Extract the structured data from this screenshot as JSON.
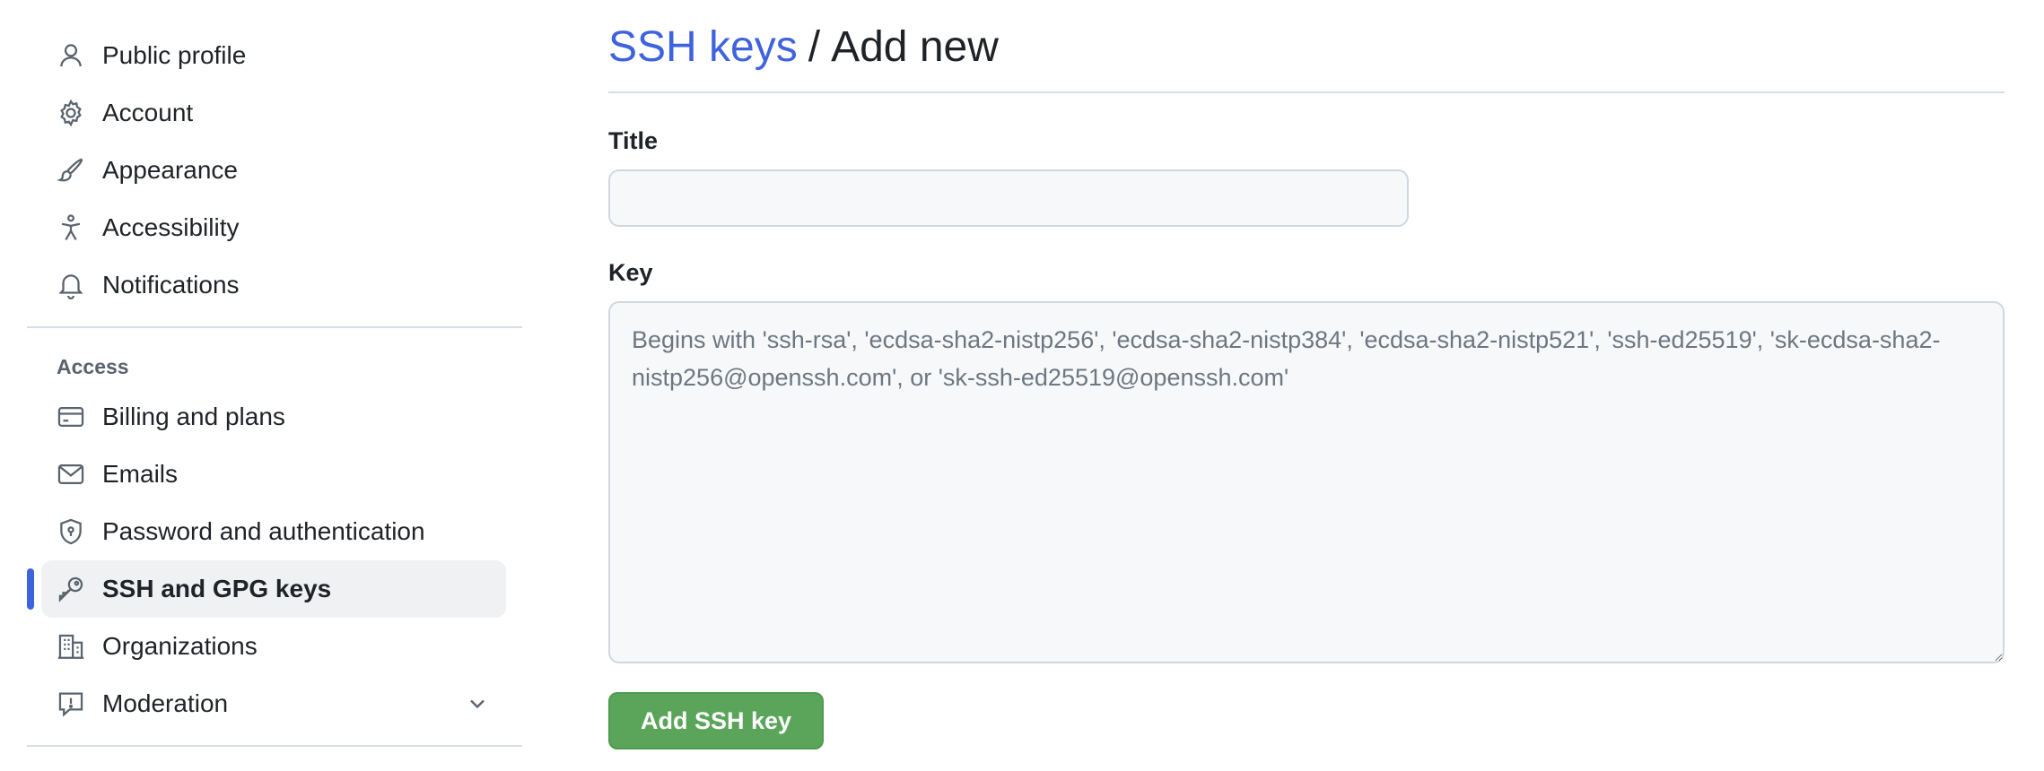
{
  "sidebar": {
    "group1": [
      {
        "label": "Public profile",
        "icon": "person-icon"
      },
      {
        "label": "Account",
        "icon": "gear-icon"
      },
      {
        "label": "Appearance",
        "icon": "paintbrush-icon"
      },
      {
        "label": "Accessibility",
        "icon": "accessibility-icon"
      },
      {
        "label": "Notifications",
        "icon": "bell-icon"
      }
    ],
    "access_heading": "Access",
    "group2": [
      {
        "label": "Billing and plans",
        "icon": "credit-card-icon"
      },
      {
        "label": "Emails",
        "icon": "mail-icon"
      },
      {
        "label": "Password and authentication",
        "icon": "shield-lock-icon"
      },
      {
        "label": "SSH and GPG keys",
        "icon": "key-icon",
        "active": true
      },
      {
        "label": "Organizations",
        "icon": "organization-icon"
      },
      {
        "label": "Moderation",
        "icon": "report-icon",
        "expandable": true
      }
    ]
  },
  "header": {
    "crumb_link": "SSH keys",
    "separator": "/",
    "title": "Add new"
  },
  "form": {
    "title_label": "Title",
    "title_value": "",
    "key_label": "Key",
    "key_value": "",
    "key_placeholder": "Begins with 'ssh-rsa', 'ecdsa-sha2-nistp256', 'ecdsa-sha2-nistp384', 'ecdsa-sha2-nistp521', 'ssh-ed25519', 'sk-ecdsa-sha2-nistp256@openssh.com', or 'sk-ssh-ed25519@openssh.com'",
    "submit_label": "Add SSH key"
  },
  "colors": {
    "accent": "#3e63dd",
    "primary_button": "#5aa55a",
    "active_bg": "#eff1f3"
  }
}
